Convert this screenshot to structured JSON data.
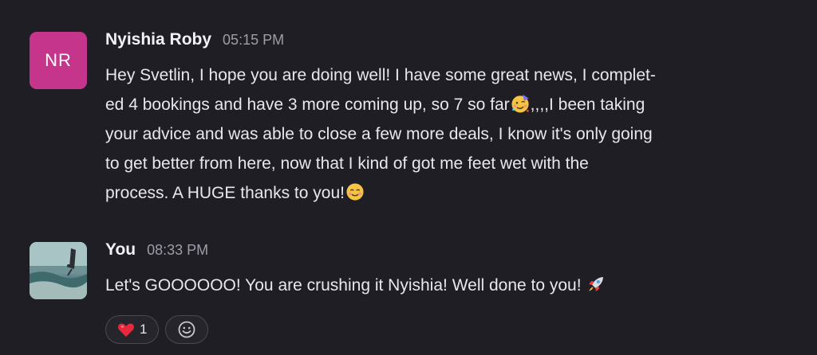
{
  "messages": [
    {
      "avatar_initials": "NR",
      "avatar_color": "#c5358c",
      "sender": "Nyishia Roby",
      "time": "05:15 PM",
      "lines": [
        "Hey Svetlin, I hope you are doing well! I have some great news, I complet-",
        "ed 4 bookings and have 3 more coming up, so 7 so far",
        ",,,,I been taking",
        "your advice and was able to close a few more deals, I know it's only going",
        "to get better from here, now that I kind of got me feet wet with the",
        "process. A HUGE thanks to you!"
      ],
      "emojis": [
        "partying-face-icon",
        "smiling-face-icon"
      ]
    },
    {
      "sender": "You",
      "time": "08:33 PM",
      "text": "Let's GOOOOOO! You are crushing it Nyishia! Well done to you!",
      "emojis": [
        "rocket-icon"
      ],
      "reactions": [
        {
          "icon": "heart-icon",
          "count": "1"
        }
      ],
      "add_reaction_icon": "add-reaction-smiley-icon"
    }
  ]
}
